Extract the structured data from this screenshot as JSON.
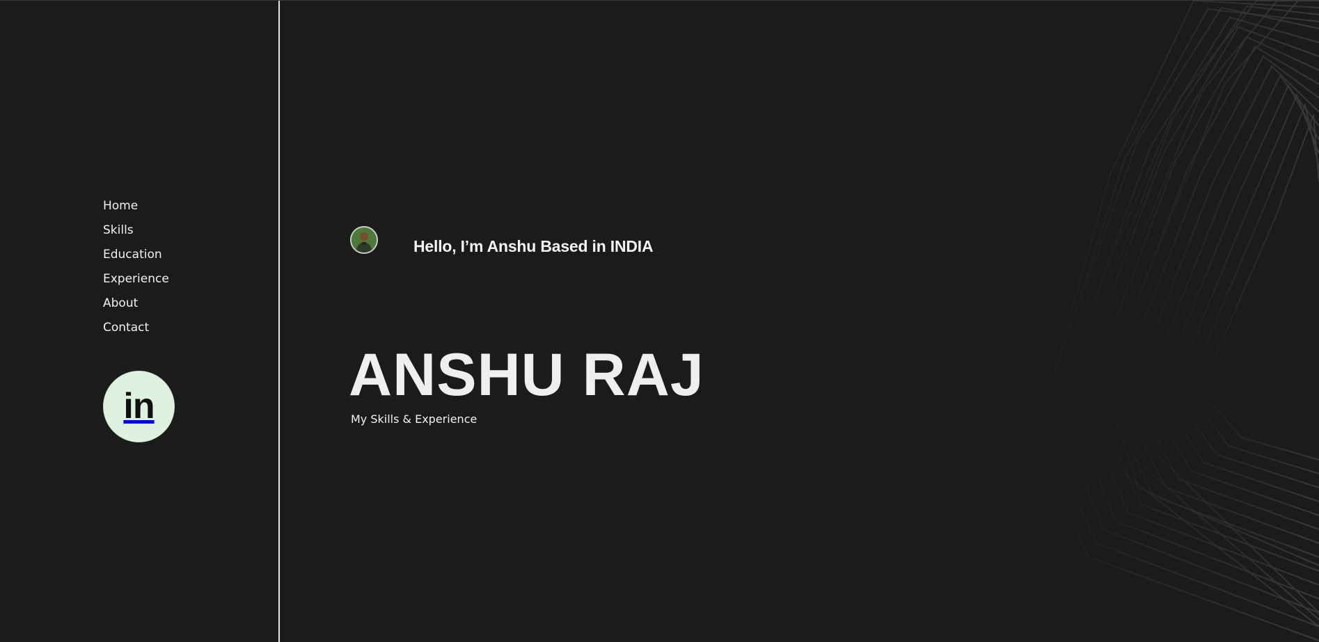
{
  "nav": {
    "items": [
      {
        "label": "Home"
      },
      {
        "label": "Skills"
      },
      {
        "label": "Education"
      },
      {
        "label": "Experience"
      },
      {
        "label": "About"
      },
      {
        "label": "Contact"
      }
    ]
  },
  "social": {
    "linkedin_label": "in"
  },
  "hero": {
    "greeting": "Hello, I’m Anshu Based in INDIA",
    "name": "ANSHU RAJ",
    "subtitle": "My Skills & Experience"
  },
  "colors": {
    "background": "#1b1b1b",
    "divider": "#e8e8e8",
    "linkedin_badge": "#dff2df",
    "text": "#f2f2f2"
  },
  "icons": {
    "linkedin": "linkedin-icon",
    "avatar": "profile-avatar"
  }
}
